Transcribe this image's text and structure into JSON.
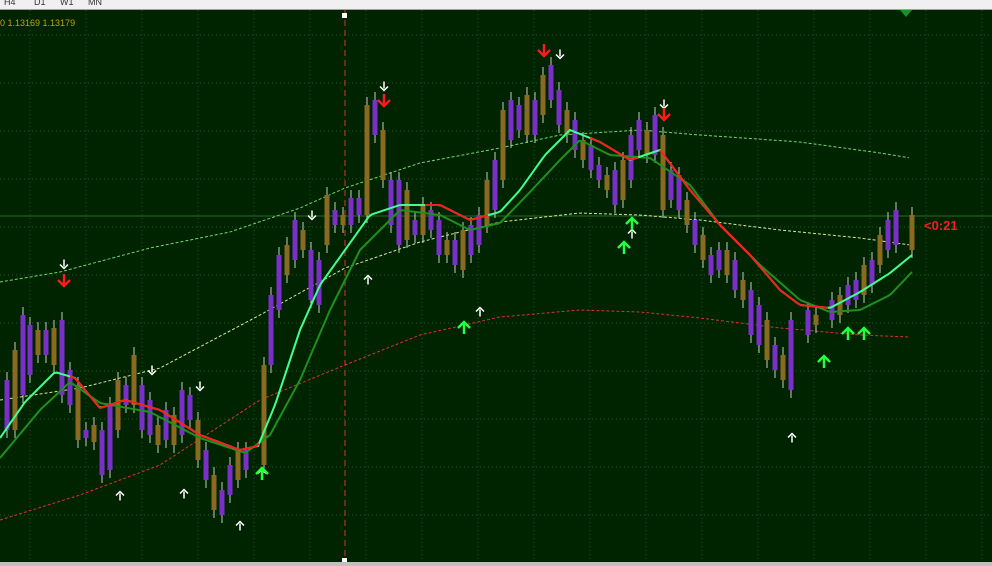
{
  "toolbar": {
    "timeframes": [
      "H4",
      "D1",
      "W1",
      "MN"
    ]
  },
  "chart": {
    "price_info": "0 1.13169 1.13179",
    "countdown": "<0:21",
    "colors": {
      "background": "#002400",
      "grid": "#1f5a1f",
      "bull_candle": "#8a6a20",
      "bear_candle": "#7a2fc8",
      "fast_ma": "#40ff90",
      "slow_ma": "#1f8f1f",
      "trend_up": "#40ff90",
      "trend_down": "#ff1a1a",
      "upper_band": "#6fd86f",
      "middle_band": "#d8e898",
      "lower_band": "#d83030",
      "period_separator": "#e03030",
      "signal_buy": "#20ff40",
      "signal_sell": "#ff1a1a",
      "signal_white": "#ffffff"
    },
    "signals": [
      {
        "type": "sell-white"
      },
      {
        "type": "sell-red"
      },
      {
        "type": "buy-white"
      },
      {
        "type": "sell-white"
      },
      {
        "type": "buy-white"
      },
      {
        "type": "sell-white"
      },
      {
        "type": "buy-white"
      },
      {
        "type": "buy-white"
      },
      {
        "type": "buy-green"
      },
      {
        "type": "sell-white"
      },
      {
        "type": "buy-white"
      },
      {
        "type": "sell-white"
      },
      {
        "type": "sell-red"
      },
      {
        "type": "buy-green"
      },
      {
        "type": "buy-white"
      },
      {
        "type": "sell-red"
      },
      {
        "type": "sell-white"
      },
      {
        "type": "buy-green"
      },
      {
        "type": "buy-white"
      },
      {
        "type": "sell-white"
      },
      {
        "type": "sell-red"
      },
      {
        "type": "buy-green"
      },
      {
        "type": "buy-white"
      },
      {
        "type": "buy-green"
      },
      {
        "type": "buy-green"
      },
      {
        "type": "buy-green"
      }
    ]
  }
}
